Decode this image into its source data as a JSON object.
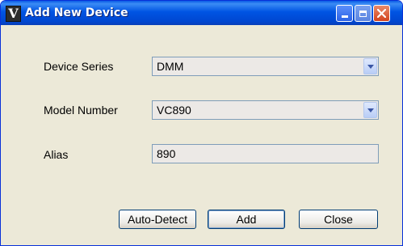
{
  "window": {
    "title": "Add New Device",
    "app_icon_letter": "V"
  },
  "form": {
    "device_series": {
      "label": "Device Series",
      "value": "DMM"
    },
    "model_number": {
      "label": "Model Number",
      "value": "VC890"
    },
    "alias": {
      "label": "Alias",
      "value": "890"
    }
  },
  "buttons": {
    "auto_detect": "Auto-Detect",
    "add": "Add",
    "close": "Close"
  },
  "colors": {
    "titlebar": "#0054e3",
    "window_bg": "#ece9d8",
    "field_border": "#7f9db9"
  }
}
